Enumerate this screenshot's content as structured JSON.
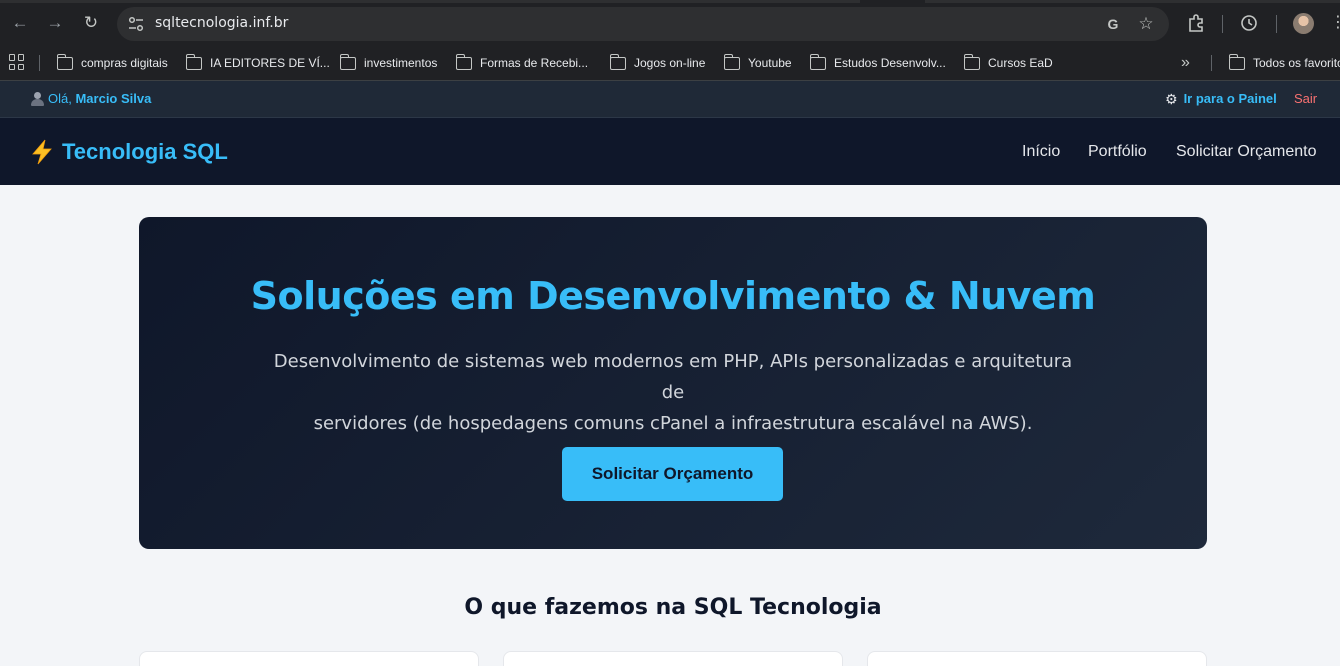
{
  "browser": {
    "url": "sqltecnologia.inf.br",
    "bookmarks": [
      "compras digitais",
      "IA EDITORES DE VÍ...",
      "investimentos",
      "Formas de Recebi...",
      "Jogos on-line",
      "Youtube",
      "Estudos Desenvolv...",
      "Cursos EaD"
    ],
    "all_bookmarks_label": "Todos os favoritos"
  },
  "admin_bar": {
    "greeting": "Olá,",
    "user_name": "Marcio Silva",
    "panel_link": "Ir para o Painel",
    "logout_link": "Sair"
  },
  "header": {
    "logo_text": "Tecnologia SQL",
    "nav": [
      "Início",
      "Portfólio",
      "Solicitar Orçamento"
    ]
  },
  "hero": {
    "title": "Soluções em Desenvolvimento & Nuvem",
    "text_line1": "Desenvolvimento de sistemas web modernos em PHP, APIs personalizadas e arquitetura de",
    "text_line2": "servidores (de hospedagens comuns cPanel a infraestrutura escalável na AWS).",
    "cta": "Solicitar Orçamento"
  },
  "section": {
    "title": "O que fazemos na SQL Tecnologia"
  },
  "colors": {
    "accent": "#38bdf8",
    "header_bg": "#0f172a",
    "logout": "#f87171"
  }
}
